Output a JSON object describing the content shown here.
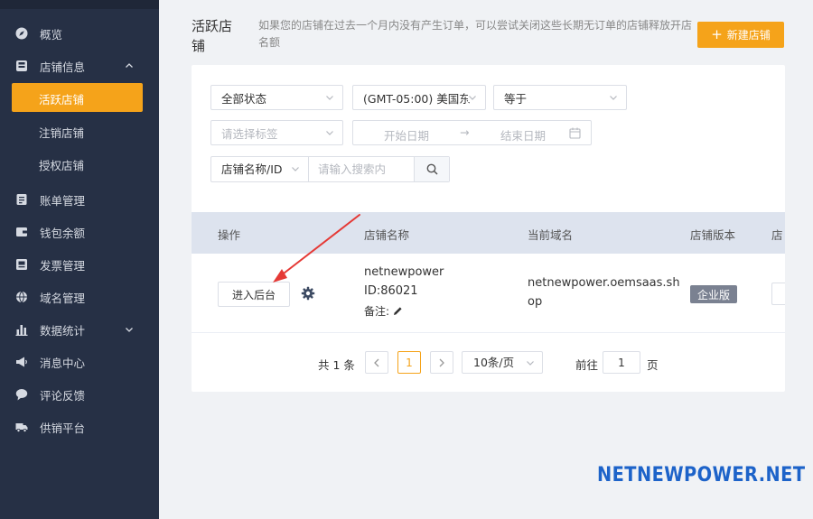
{
  "sidebar": {
    "items": [
      {
        "label": "概览",
        "icon": "compass-icon"
      },
      {
        "label": "店铺信息",
        "icon": "store-icon",
        "expanded": true
      },
      {
        "label": "活跃店铺",
        "active": true
      },
      {
        "label": "注销店铺"
      },
      {
        "label": "授权店铺"
      },
      {
        "label": "账单管理",
        "icon": "bill-icon"
      },
      {
        "label": "钱包余额",
        "icon": "wallet-icon"
      },
      {
        "label": "发票管理",
        "icon": "invoice-icon"
      },
      {
        "label": "域名管理",
        "icon": "globe-icon"
      },
      {
        "label": "数据统计",
        "icon": "bar-chart-icon",
        "expandable": true
      },
      {
        "label": "消息中心",
        "icon": "megaphone-icon"
      },
      {
        "label": "评论反馈",
        "icon": "comment-icon"
      },
      {
        "label": "供销平台",
        "icon": "truck-icon"
      }
    ]
  },
  "header": {
    "title": "活跃店铺",
    "description": "如果您的店铺在过去一个月内没有产生订单，可以尝试关闭这些长期无订单的店铺释放开店名额",
    "new_button": "新建店铺"
  },
  "filters": {
    "status": "全部状态",
    "timezone": "(GMT-05:00) 美国东",
    "operator": "等于",
    "tag_placeholder": "请选择标签",
    "start_date_placeholder": "开始日期",
    "end_date_placeholder": "结束日期",
    "search_type": "店铺名称/ID",
    "search_placeholder": "请输入搜索内"
  },
  "table": {
    "columns": [
      "操作",
      "店铺名称",
      "当前域名",
      "店铺版本",
      "店"
    ],
    "rows": [
      {
        "action_label": "进入后台",
        "store_name": "netnewpower",
        "store_id": "ID:86021",
        "note_label": "备注:",
        "domain_line1": "netnewpower.oemsaas.sh",
        "domain_line2": "op",
        "version": "企业版"
      }
    ]
  },
  "pagination": {
    "total": "共 1 条",
    "current_page": "1",
    "page_size": "10条/页",
    "goto_label": "前往",
    "goto_value": "1",
    "page_suffix": "页"
  },
  "watermark": "NETNEWPOWER.NET",
  "colors": {
    "sidebar_bg": "#263045",
    "accent": "#f5a31a",
    "table_header_bg": "#dde3ee",
    "badge_bg": "#7a8191",
    "arrow": "#e53935",
    "watermark": "#1d63c9"
  }
}
